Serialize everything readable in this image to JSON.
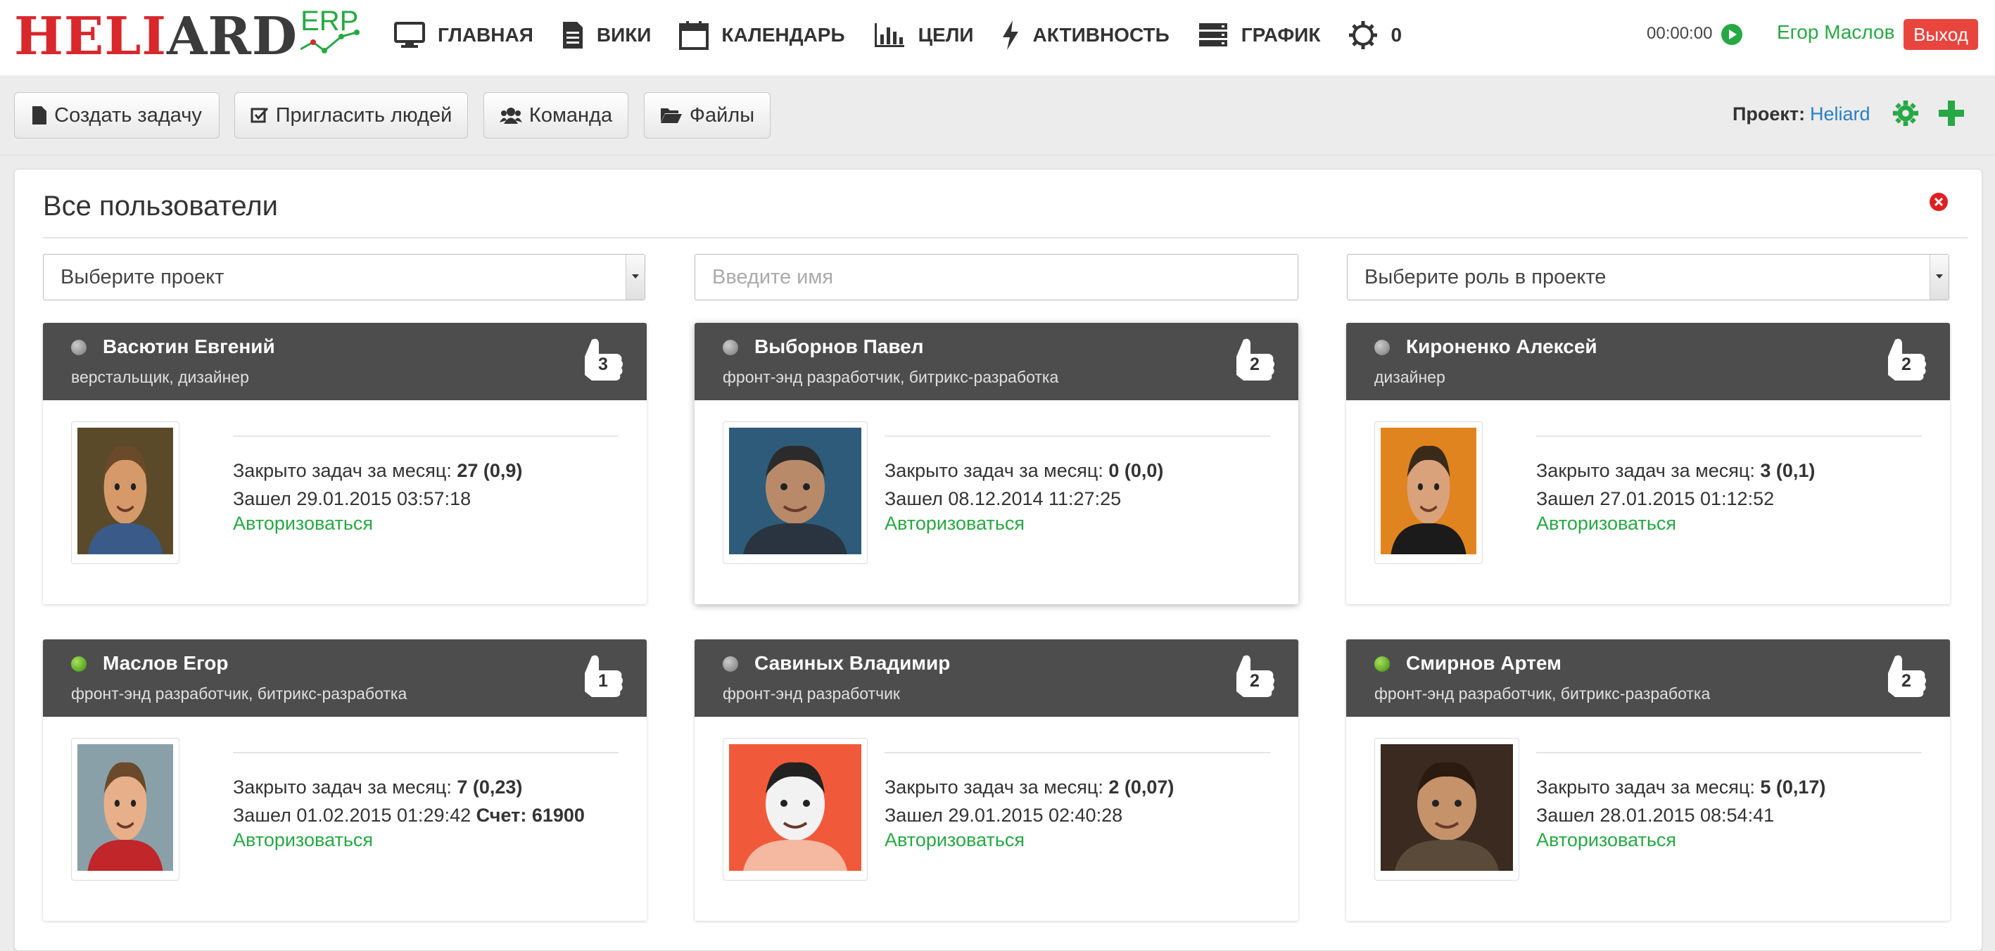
{
  "logo": {
    "main_red": "HELI",
    "main_dark": "ARD",
    "sub": "ERP"
  },
  "nav": [
    {
      "label": "ГЛАВНАЯ",
      "icon": "monitor-icon"
    },
    {
      "label": "ВИКИ",
      "icon": "document-icon"
    },
    {
      "label": "КАЛЕНДАРЬ",
      "icon": "calendar-icon"
    },
    {
      "label": "ЦЕЛИ",
      "icon": "bar-chart-icon"
    },
    {
      "label": "АКТИВНОСТЬ",
      "icon": "lightning-icon"
    },
    {
      "label": "ГРАФИК",
      "icon": "server-icon"
    },
    {
      "label": "0",
      "icon": "gear-icon"
    }
  ],
  "header": {
    "timer": "00:00:00",
    "user_name": "Егор Маслов",
    "logout": "Выход"
  },
  "toolbar": {
    "create_task": "Создать задачу",
    "invite": "Пригласить людей",
    "team": "Команда",
    "files": "Файлы",
    "project_label": "Проект:",
    "project_name": "Heliard"
  },
  "panel": {
    "title": "Все пользователи",
    "project_select": "Выберите проект",
    "name_placeholder": "Введите имя",
    "role_select": "Выберите роль в проекте"
  },
  "labels": {
    "closed_tasks": "Закрыто задач за месяц:",
    "visited": "Зашел",
    "authorize": "Авторизоваться",
    "score": "Счет:"
  },
  "users": [
    {
      "name": "Васютин Евгений",
      "role": "верстальщик, дизайнер",
      "likes": "3",
      "online": false,
      "closed": "27 (0,9)",
      "visited": "29.01.2015 03:57:18",
      "score": ""
    },
    {
      "name": "Выборнов Павел",
      "role": "фронт-энд разработчик, битрикс-разработка",
      "likes": "2",
      "online": false,
      "closed": "0 (0,0)",
      "visited": "08.12.2014 11:27:25",
      "score": ""
    },
    {
      "name": "Кироненко Алексей",
      "role": "дизайнер",
      "likes": "2",
      "online": false,
      "closed": "3 (0,1)",
      "visited": "27.01.2015 01:12:52",
      "score": ""
    },
    {
      "name": "Маслов Егор",
      "role": "фронт-энд разработчик, битрикс-разработка",
      "likes": "1",
      "online": true,
      "closed": "7 (0,23)",
      "visited": "01.02.2015 01:29:42",
      "score": "61900"
    },
    {
      "name": "Савиных Владимир",
      "role": "фронт-энд разработчик",
      "likes": "2",
      "online": false,
      "closed": "2 (0,07)",
      "visited": "29.01.2015 02:40:28",
      "score": ""
    },
    {
      "name": "Смирнов Артем",
      "role": "фронт-энд разработчик, битрикс-разработка",
      "likes": "2",
      "online": true,
      "closed": "5 (0,17)",
      "visited": "28.01.2015 08:54:41",
      "score": ""
    }
  ],
  "colors": {
    "accent_green": "#27a844",
    "logout_red": "#e9453f",
    "card_header": "#4d4d4d",
    "link_blue": "#2a7fc1"
  }
}
